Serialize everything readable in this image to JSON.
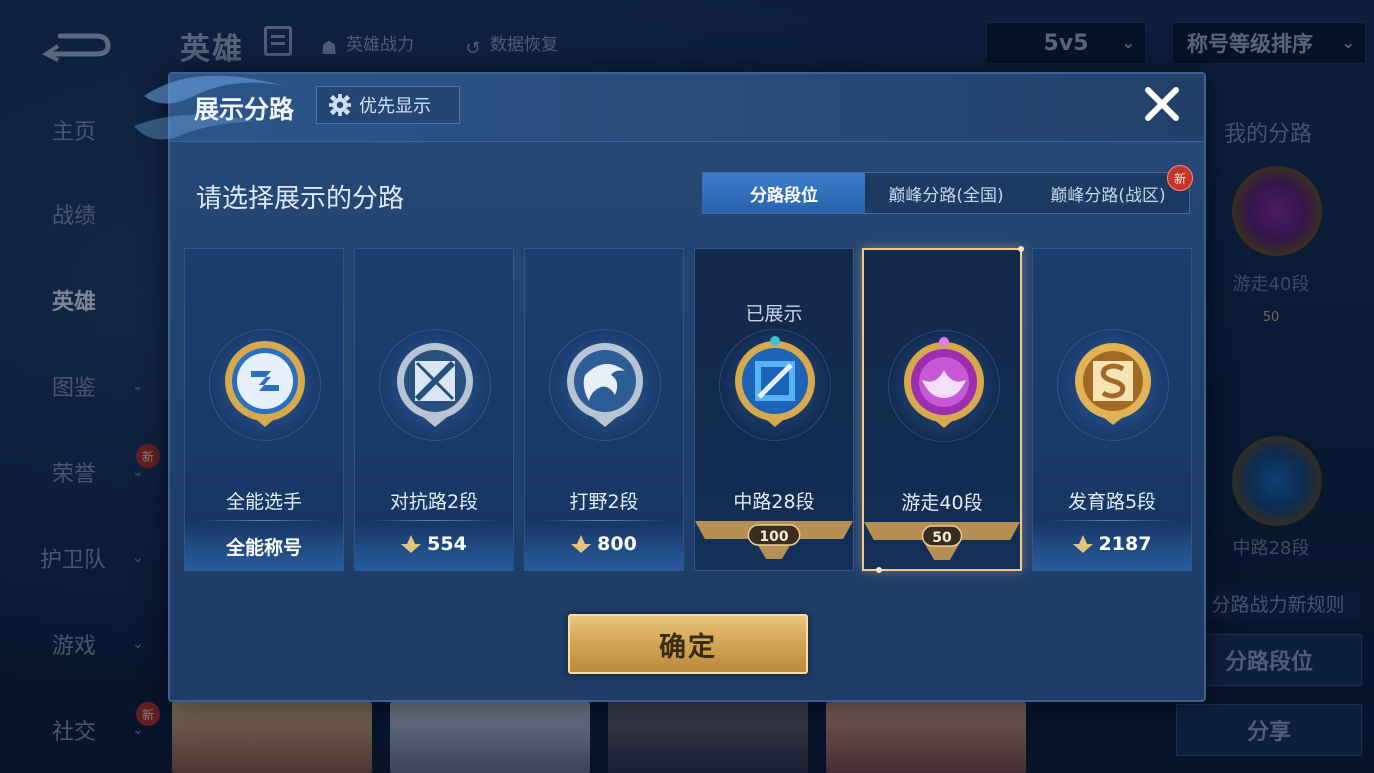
{
  "background": {
    "top_title": "英雄",
    "hero_power": "英雄战力",
    "data_recover": "数据恢复",
    "mode_select": "5v5",
    "sort_select": "称号等级排序",
    "nav": [
      {
        "label": "主页"
      },
      {
        "label": "战绩"
      },
      {
        "label": "英雄",
        "active": true
      },
      {
        "label": "图鉴"
      },
      {
        "label": "荣誉",
        "new": "新"
      },
      {
        "label": "护卫队"
      },
      {
        "label": "游戏"
      },
      {
        "label": "社交",
        "new": "新"
      }
    ],
    "right_panel": {
      "title": "我的分路",
      "lane1": "游走40段",
      "lane1_rank": "50",
      "lane2": "中路28段",
      "rule": "分路战力新规则",
      "btn_lane_rank": "分路段位",
      "btn_share": "分享"
    }
  },
  "modal": {
    "title": "展示分路",
    "priority_button": "优先显示",
    "subtitle": "请选择展示的分路",
    "tabs": [
      {
        "label": "分路段位",
        "active": true
      },
      {
        "label": "巅峰分路(全国)"
      },
      {
        "label": "巅峰分路(战区)",
        "new": "新"
      }
    ],
    "cards": [
      {
        "name": "全能选手",
        "value": "全能称号",
        "emblem": "all-rounder-emblem"
      },
      {
        "name": "对抗路2段",
        "value": "554",
        "emblem": "clash-lane-emblem"
      },
      {
        "name": "打野2段",
        "value": "800",
        "emblem": "jungle-emblem"
      },
      {
        "name": "中路28段",
        "rank": "100",
        "shown": "已展示",
        "emblem": "mid-lane-emblem"
      },
      {
        "name": "游走40段",
        "rank": "50",
        "selected": true,
        "emblem": "roam-emblem"
      },
      {
        "name": "发育路5段",
        "value": "2187",
        "emblem": "farm-lane-emblem"
      }
    ],
    "confirm": "确定"
  },
  "colors": {
    "accent_tab": "#2a63ad",
    "gold": "#d2a554",
    "selected_border": "#f3c98a"
  }
}
